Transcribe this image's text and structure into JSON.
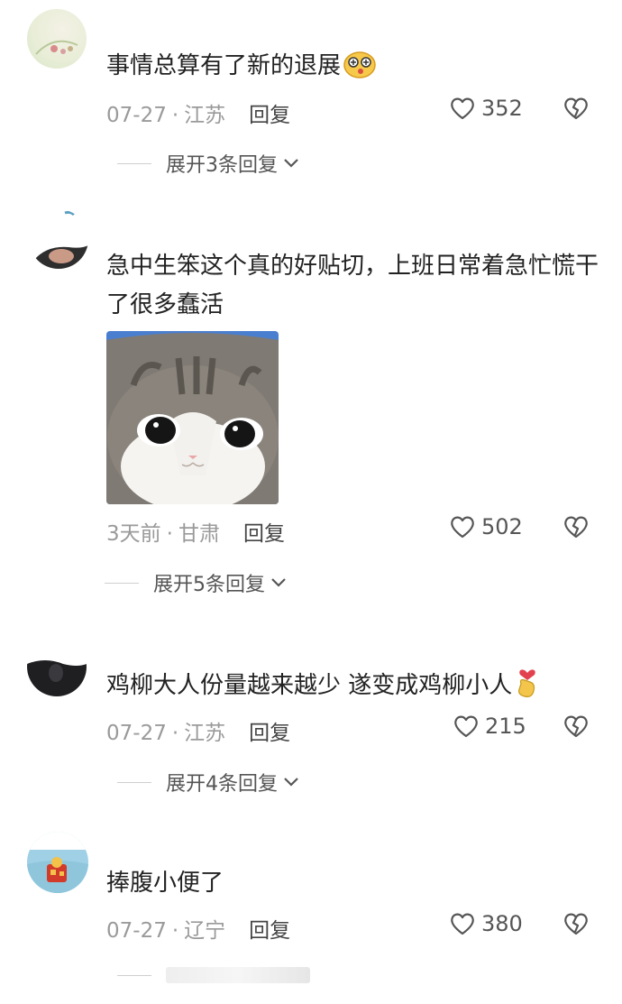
{
  "comments": [
    {
      "text": "事情总算有了新的退展",
      "date": "07-27",
      "location": "江苏",
      "reply_label": "回复",
      "likes": "352",
      "expand_label": "展开3条回复"
    },
    {
      "text": "急中生笨这个真的好贴切，上班日常着急忙慌干了很多蠢活",
      "date": "3天前",
      "location": "甘肃",
      "reply_label": "回复",
      "likes": "502",
      "expand_label": "展开5条回复"
    },
    {
      "text": "鸡柳大人份量越来越少 遂变成鸡柳小人",
      "date": "07-27",
      "location": "江苏",
      "reply_label": "回复",
      "likes": "215",
      "expand_label": "展开4条回复"
    },
    {
      "text": "捧腹小便了",
      "date": "07-27",
      "location": "辽宁",
      "reply_label": "回复",
      "likes": "380"
    }
  ],
  "meta_separator": "·",
  "icons": {
    "like": "heart-outline-icon",
    "dislike": "broken-heart-icon",
    "expand": "chevron-down-icon"
  },
  "colors": {
    "meta": "#9a9a9a",
    "text": "#222222",
    "reply": "#444444"
  }
}
